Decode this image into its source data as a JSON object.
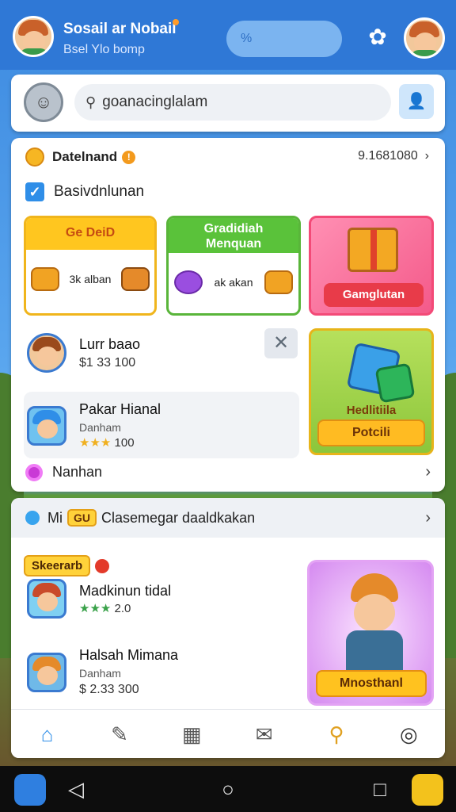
{
  "header": {
    "title": "Sosail ar Nobail",
    "subtitle": "Bsel Ylo bomp",
    "pill_text": "%"
  },
  "search": {
    "placeholder": "goanacinglalam"
  },
  "main": {
    "section_title": "Datelnand",
    "section_value": "9.1681080",
    "check_label": "Basivdnlunan",
    "tiles": [
      {
        "title": "Ge DeiD",
        "item_text": "3k alban"
      },
      {
        "title": "Gradidiah\nMenquan",
        "item_text": "ak akan"
      },
      {
        "button": "Gamglutan"
      },
      {
        "label": "Hedlitiila",
        "button": "Potcili"
      }
    ],
    "rows": [
      {
        "name": "Lurr baao",
        "value": "$1 33 100"
      },
      {
        "name": "Pakar Hianal",
        "sub": "Danham",
        "stars_value": "100"
      }
    ],
    "bottom_row": "Nanhan"
  },
  "lower": {
    "head_badge": "Mi",
    "head_badge2": "GU",
    "head_title": "Clasemegar daaldkakan",
    "tag": "Skeerarb",
    "rows": [
      {
        "name": "Madkinun tidal",
        "stars_value": "2.0"
      },
      {
        "name": "Halsah Mimana",
        "sub": "Danham",
        "value": "$ 2.33 300"
      }
    ],
    "hero_button": "Mnosthanl"
  },
  "icons": {
    "nav": [
      "home-icon",
      "brush-icon",
      "document-icon",
      "notification-icon",
      "location-icon",
      "settings-icon"
    ]
  },
  "colors": {
    "header_blue": "#2f78d6",
    "accent_orange": "#f39a1d",
    "accent_yellow": "#ffc61f",
    "accent_green": "#5ac23a",
    "accent_pink": "#f45a8a"
  }
}
